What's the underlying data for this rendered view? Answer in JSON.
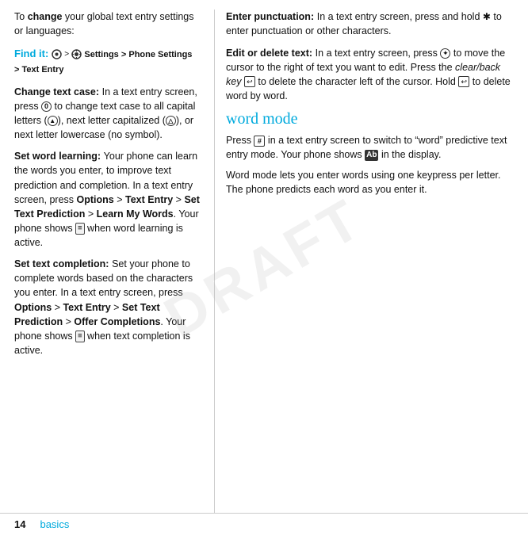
{
  "intro": {
    "text1": "To ",
    "text1_bold": "change",
    "text1_rest": " your global text entry settings or languages:"
  },
  "find_it": {
    "label": "Find it:",
    "path_bold": "Settings > Phone Settings",
    "path_rest": "> Text Entry"
  },
  "sections_left": [
    {
      "id": "change-text-case",
      "title": "Change text case:",
      "body": " In a text entry screen, press  to change text case to all capital letters (  ), next letter capitalized (  ), or next letter lowercase (no symbol)."
    },
    {
      "id": "set-word-learning",
      "title": "Set word learning:",
      "body": " Your phone can learn the words you enter, to improve text prediction and completion. In a text entry screen, press Options > Text Entry > Set Text Prediction > Learn My Words. Your phone shows   when word learning is active."
    },
    {
      "id": "set-text-completion",
      "title": "Set text completion:",
      "body": " Set your phone to complete words based on the characters you enter. In a text entry screen, press Options > Text Entry > Set Text Prediction > Offer Completions. Your phone shows   when text completion is active."
    }
  ],
  "sections_right": [
    {
      "id": "enter-punctuation",
      "title": "Enter punctuation:",
      "body": " In a text entry screen, press and hold   to enter punctuation or other characters."
    },
    {
      "id": "edit-or-delete",
      "title": "Edit or delete text:",
      "body": " In a text entry screen, press   to move the cursor to the right of text you want to edit. Press the clear/back key   to delete the character left of the cursor. Hold   to delete word by word."
    }
  ],
  "word_mode": {
    "heading": "word mode",
    "para1": "Press   in a text entry screen to switch to “word” predictive text entry mode. Your phone shows   in the display.",
    "para2": "Word mode lets you enter words using one keypress per letter. The phone predicts each word as you enter it."
  },
  "footer": {
    "page_num": "14",
    "section": "basics"
  }
}
